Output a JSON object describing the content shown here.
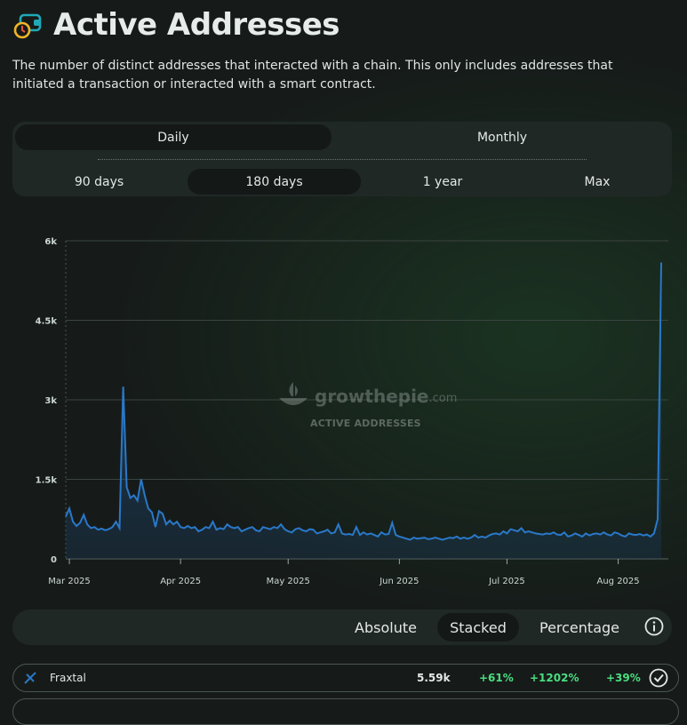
{
  "header": {
    "title": "Active Addresses",
    "icon": "wallet-clock-icon"
  },
  "description": "The number of distinct addresses that interacted with a chain. This only includes addresses that initiated a transaction or interacted with a smart contract.",
  "interval_tabs": [
    {
      "label": "Daily",
      "active": true
    },
    {
      "label": "Monthly",
      "active": false
    }
  ],
  "range_tabs": [
    {
      "label": "90 days",
      "active": false
    },
    {
      "label": "180 days",
      "active": true
    },
    {
      "label": "1 year",
      "active": false
    },
    {
      "label": "Max",
      "active": false
    }
  ],
  "watermark": {
    "brand": "growthepie",
    "domain": ".com",
    "subtitle": "ACTIVE ADDRESSES"
  },
  "chart_data": {
    "type": "area",
    "series": [
      {
        "name": "Fraxtal",
        "color": "#2a78c9"
      }
    ],
    "y_ticks": [
      "6k",
      "4.5k",
      "3k",
      "1.5k",
      "0"
    ],
    "ylim": [
      0,
      6000
    ],
    "x_ticks": [
      "Mar 2025",
      "Apr 2025",
      "May 2025",
      "Jun 2025",
      "Jul 2025",
      "Aug 2025"
    ],
    "x_start": "2025-02-28",
    "values": [
      800,
      950,
      700,
      620,
      680,
      830,
      650,
      580,
      600,
      550,
      570,
      540,
      560,
      600,
      700,
      580,
      3250,
      1350,
      1150,
      1200,
      1100,
      1500,
      1200,
      950,
      880,
      600,
      900,
      850,
      650,
      720,
      650,
      700,
      600,
      580,
      620,
      580,
      600,
      520,
      550,
      600,
      580,
      700,
      550,
      580,
      560,
      650,
      600,
      580,
      600,
      520,
      550,
      580,
      600,
      540,
      520,
      600,
      580,
      560,
      600,
      580,
      650,
      560,
      520,
      500,
      560,
      580,
      540,
      520,
      560,
      550,
      480,
      500,
      520,
      550,
      480,
      500,
      650,
      480,
      460,
      470,
      450,
      600,
      450,
      500,
      460,
      480,
      450,
      420,
      500,
      460,
      470,
      680,
      450,
      420,
      400,
      380,
      360,
      400,
      380,
      390,
      400,
      370,
      380,
      400,
      380,
      360,
      380,
      400,
      390,
      420,
      380,
      400,
      380,
      400,
      450,
      400,
      420,
      400,
      440,
      470,
      480,
      460,
      520,
      480,
      560,
      540,
      520,
      580,
      500,
      520,
      500,
      480,
      470,
      460,
      480,
      470,
      500,
      460,
      450,
      500,
      420,
      440,
      480,
      450,
      420,
      480,
      440,
      470,
      480,
      460,
      500,
      460,
      440,
      500,
      480,
      440,
      420,
      480,
      460,
      450,
      470,
      440,
      460,
      420,
      480,
      750,
      5590
    ],
    "grid": true,
    "legend": "none"
  },
  "modes": [
    {
      "label": "Absolute",
      "active": false
    },
    {
      "label": "Stacked",
      "active": true
    },
    {
      "label": "Percentage",
      "active": false
    }
  ],
  "info_icon": "info-icon",
  "chain_row": {
    "icon": "fraxtal-icon",
    "name": "Fraxtal",
    "value": "5.59k",
    "change_a": "+61%",
    "change_b": "+1202%",
    "change_c": "+39%",
    "check_icon": "check-circle-icon",
    "positive_color": "#4ade80"
  }
}
